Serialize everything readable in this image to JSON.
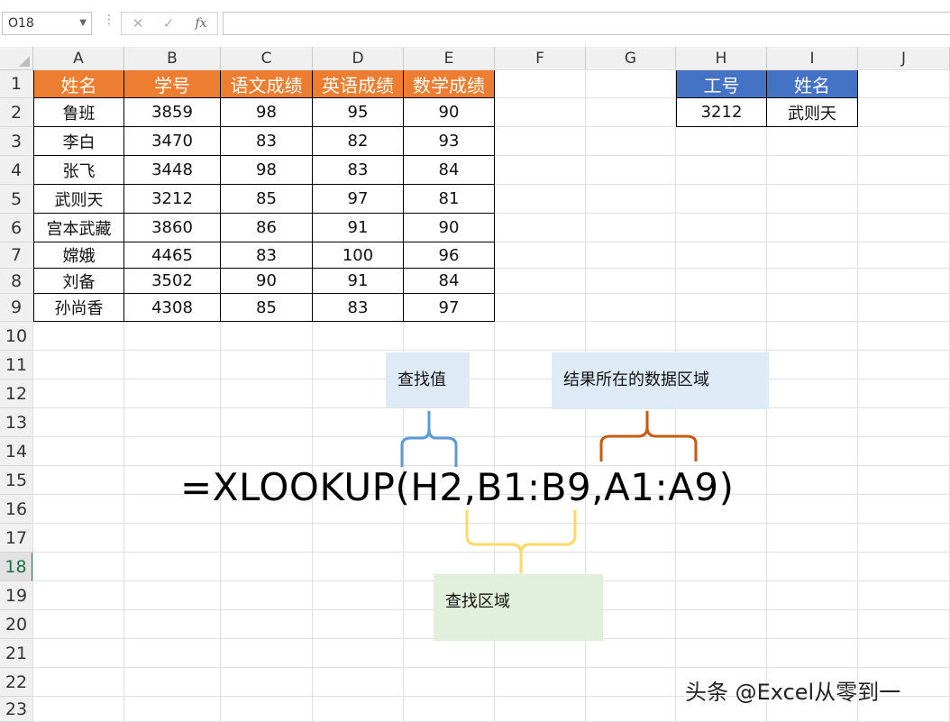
{
  "formula_bar": {
    "name_box": "O18",
    "cancel_icon": "✕",
    "enter_icon": "✓",
    "fx_label": "fx",
    "formula_value": ""
  },
  "columns": [
    "A",
    "B",
    "C",
    "D",
    "E",
    "F",
    "G",
    "H",
    "I",
    "J"
  ],
  "rows": [
    "1",
    "2",
    "3",
    "4",
    "5",
    "6",
    "7",
    "8",
    "9",
    "10",
    "11",
    "12",
    "13",
    "14",
    "15",
    "16",
    "17",
    "18",
    "19",
    "20",
    "21",
    "22",
    "23"
  ],
  "selected_row": "18",
  "table": {
    "headers": [
      "姓名",
      "学号",
      "语文成绩",
      "英语成绩",
      "数学成绩"
    ],
    "rows": [
      [
        "鲁班",
        "3859",
        "98",
        "95",
        "90"
      ],
      [
        "李白",
        "3470",
        "83",
        "82",
        "93"
      ],
      [
        "张飞",
        "3448",
        "98",
        "83",
        "84"
      ],
      [
        "武则天",
        "3212",
        "85",
        "97",
        "81"
      ],
      [
        "宫本武藏",
        "3860",
        "86",
        "91",
        "90"
      ],
      [
        "嫦娥",
        "4465",
        "83",
        "100",
        "96"
      ],
      [
        "刘备",
        "3502",
        "90",
        "91",
        "84"
      ],
      [
        "孙尚香",
        "4308",
        "85",
        "83",
        "97"
      ]
    ],
    "header_color": "#ED7D31"
  },
  "lookup": {
    "headers": [
      "工号",
      "姓名"
    ],
    "values": [
      "3212",
      "武则天"
    ],
    "header_color": "#4472C4"
  },
  "annotations": {
    "lookup_value": "查找值",
    "result_range": "结果所在的数据区域",
    "lookup_range": "查找区域",
    "formula": "=XLOOKUP(H2,B1:B9,A1:A9)",
    "colors": {
      "blue": "#5B9BD5",
      "orange": "#C55A11",
      "yellow": "#FFD966",
      "box_blue": "#DEEBF7",
      "box_green": "#E2EFDA"
    }
  },
  "watermark": "头条 @Excel从零到一"
}
